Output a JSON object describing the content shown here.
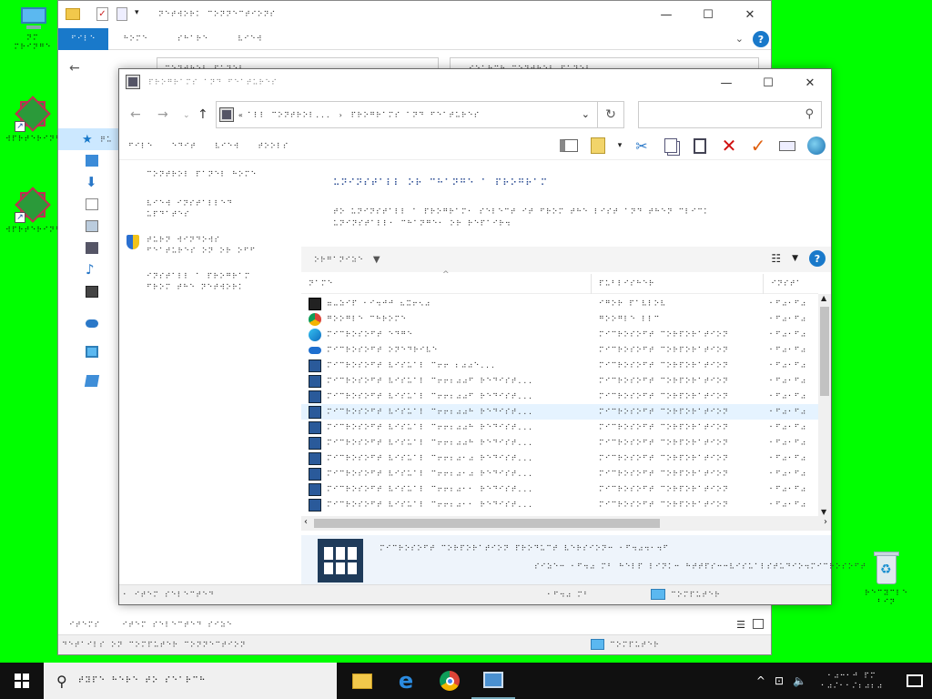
{
  "desktop": {
    "icons": [
      {
        "name": "this-pc",
        "label": "⠝⠍\n⠍⠗⠊⠝⠛⠑"
      },
      {
        "name": "shortcut-1",
        "label": "⠺⠏⠗⠞⠑⠗⠊⠝⠛⠗"
      },
      {
        "name": "shortcut-2",
        "label": "⠺⠏⠗⠞⠑⠗⠊⠝⠛⠗"
      },
      {
        "name": "recycle-bin",
        "label": "⠗⠑⠉⠽⠉⠇⠑\n⠃⠊⠝"
      }
    ]
  },
  "back_window": {
    "title": "⠝⠑⠞⠺⠕⠗⠅ ⠉⠕⠝⠝⠑⠉⠞⠊⠕⠝⠎",
    "tabs": [
      "⠋⠊⠇⠑",
      "⠓⠕⠍⠑",
      "⠎⠓⠁⠗⠑",
      "⠧⠊⠑⠺"
    ],
    "address": "⠉⠕⠝⠞⠗⠕⠇ ⠏⠁⠝⠑⠇",
    "search_placeholder": "⠎⠑⠁⠗⠉⠓ ⠉⠕⠝⠞⠗⠕⠇ ⠏⠁⠝⠑⠇",
    "side_items": [
      "⠟⠥",
      "⠙⠑",
      "⠙⠕",
      "⠙⠕",
      "⠏⠊",
      "⠙⠑",
      "⠍⠥",
      "⠧⠊",
      "⠕⠝",
      "⠞⠓",
      "⠝⠑"
    ],
    "status_left": "⠊⠞⠑⠍⠎",
    "status_mid": "⠊⠞⠑⠍ ⠎⠑⠇⠑⠉⠞⠑⠙ ⠎⠊⠵⠑",
    "footer_left": "⠙⠑⠞⠁⠊⠇⠎ ⠕⠝ ⠉⠕⠍⠏⠥⠞⠑⠗ ⠉⠕⠝⠝⠑⠉⠞⠊⠕⠝",
    "footer_right": "⠉⠕⠍⠏⠥⠞⠑⠗"
  },
  "front_window": {
    "title": "⠏⠗⠕⠛⠗⠁⠍⠎ ⠁⠝⠙ ⠋⠑⠁⠞⠥⠗⠑⠎",
    "address_parts": [
      "«",
      "⠁⠇⠇ ⠉⠕⠝⠞⠗⠕⠇...",
      "›",
      "⠏⠗⠕⠛⠗⠁⠍⠎ ⠁⠝⠙ ⠋⠑⠁⠞⠥⠗⠑⠎"
    ],
    "search_placeholder": "",
    "menu": [
      "⠋⠊⠇⠑",
      "⠑⠙⠊⠞",
      "⠧⠊⠑⠺",
      "⠞⠕⠕⠇⠎"
    ],
    "left_nav": [
      "⠉⠕⠝⠞⠗⠕⠇ ⠏⠁⠝⠑⠇ ⠓⠕⠍⠑",
      "⠧⠊⠑⠺ ⠊⠝⠎⠞⠁⠇⠇⠑⠙\n⠥⠏⠙⠁⠞⠑⠎",
      "⠞⠥⠗⠝ ⠺⠊⠝⠙⠕⠺⠎\n⠋⠑⠁⠞⠥⠗⠑⠎ ⠕⠝ ⠕⠗ ⠕⠋⠋",
      "⠊⠝⠎⠞⠁⠇⠇ ⠁ ⠏⠗⠕⠛⠗⠁⠍\n⠋⠗⠕⠍ ⠞⠓⠑ ⠝⠑⠞⠺⠕⠗⠅"
    ],
    "heading": "⠥⠝⠊⠝⠎⠞⠁⠇⠇ ⠕⠗ ⠉⠓⠁⠝⠛⠑ ⠁ ⠏⠗⠕⠛⠗⠁⠍",
    "description": "⠞⠕ ⠥⠝⠊⠝⠎⠞⠁⠇⠇ ⠁ ⠏⠗⠕⠛⠗⠁⠍⠂ ⠎⠑⠇⠑⠉⠞ ⠊⠞ ⠋⠗⠕⠍ ⠞⠓⠑ ⠇⠊⠎⠞ ⠁⠝⠙ ⠞⠓⠑⠝ ⠉⠇⠊⠉⠅\n⠥⠝⠊⠝⠎⠞⠁⠇⠇⠂ ⠉⠓⠁⠝⠛⠑⠂ ⠕⠗ ⠗⠑⠏⠁⠊⠗⠲",
    "organize": "⠕⠗⠛⠁⠝⠊⠵⠑",
    "columns": [
      "⠝⠁⠍⠑",
      "⠏⠥⠃⠇⠊⠎⠓⠑⠗",
      "⠊⠝⠎⠞⠁"
    ],
    "rows": [
      {
        "icon": "7zip-icon",
        "name": "⠶⠤⠵⠊⠏ ⠂⠊⠲⠚⠚ ⠦⠭⠖⠢⠴",
        "publisher": "⠊⠛⠕⠗ ⠏⠁⠧⠇⠕⠧",
        "date": "⠂⠋⠴⠂⠋⠴"
      },
      {
        "icon": "chrome-icon",
        "name": "⠛⠕⠕⠛⠇⠑ ⠉⠓⠗⠕⠍⠑",
        "publisher": "⠛⠕⠕⠛⠇⠑ ⠇⠇⠉",
        "date": "⠂⠋⠴⠂⠋⠴"
      },
      {
        "icon": "edge-icon",
        "name": "⠍⠊⠉⠗⠕⠎⠕⠋⠞ ⠑⠙⠛⠑",
        "publisher": "⠍⠊⠉⠗⠕⠎⠕⠋⠞ ⠉⠕⠗⠏⠕⠗⠁⠞⠊⠕⠝",
        "date": "⠂⠋⠴⠂⠋⠴"
      },
      {
        "icon": "onedrive-icon",
        "name": "⠍⠊⠉⠗⠕⠎⠕⠋⠞ ⠕⠝⠑⠙⠗⠊⠧⠑",
        "publisher": "⠍⠊⠉⠗⠕⠎⠕⠋⠞ ⠉⠕⠗⠏⠕⠗⠁⠞⠊⠕⠝",
        "date": "⠂⠋⠴⠂⠋⠴"
      },
      {
        "icon": "vcredist-icon",
        "name": "⠍⠊⠉⠗⠕⠎⠕⠋⠞ ⠧⠊⠎⠥⠁⠇ ⠉⠖⠖ ⠆⠴⠴⠑...",
        "publisher": "⠍⠊⠉⠗⠕⠎⠕⠋⠞ ⠉⠕⠗⠏⠕⠗⠁⠞⠊⠕⠝",
        "date": "⠂⠋⠴⠂⠋⠴"
      },
      {
        "icon": "vcredist-icon",
        "name": "⠍⠊⠉⠗⠕⠎⠕⠋⠞ ⠧⠊⠎⠥⠁⠇ ⠉⠖⠖⠆⠴⠴⠋ ⠗⠑⠙⠊⠎⠞...",
        "publisher": "⠍⠊⠉⠗⠕⠎⠕⠋⠞ ⠉⠕⠗⠏⠕⠗⠁⠞⠊⠕⠝",
        "date": "⠂⠋⠴⠂⠋⠴"
      },
      {
        "icon": "vcredist-icon",
        "name": "⠍⠊⠉⠗⠕⠎⠕⠋⠞ ⠧⠊⠎⠥⠁⠇ ⠉⠖⠖⠆⠴⠴⠋ ⠗⠑⠙⠊⠎⠞...",
        "publisher": "⠍⠊⠉⠗⠕⠎⠕⠋⠞ ⠉⠕⠗⠏⠕⠗⠁⠞⠊⠕⠝",
        "date": "⠂⠋⠴⠂⠋⠴"
      },
      {
        "icon": "vcredist-icon",
        "name": "⠍⠊⠉⠗⠕⠎⠕⠋⠞ ⠧⠊⠎⠥⠁⠇ ⠉⠖⠖⠆⠴⠴⠓ ⠗⠑⠙⠊⠎⠞...",
        "publisher": "⠍⠊⠉⠗⠕⠎⠕⠋⠞ ⠉⠕⠗⠏⠕⠗⠁⠞⠊⠕⠝",
        "date": "⠂⠋⠴⠂⠋⠴"
      },
      {
        "icon": "vcredist-icon",
        "name": "⠍⠊⠉⠗⠕⠎⠕⠋⠞ ⠧⠊⠎⠥⠁⠇ ⠉⠖⠖⠆⠴⠴⠓ ⠗⠑⠙⠊⠎⠞...",
        "publisher": "⠍⠊⠉⠗⠕⠎⠕⠋⠞ ⠉⠕⠗⠏⠕⠗⠁⠞⠊⠕⠝",
        "date": "⠂⠋⠴⠂⠋⠴"
      },
      {
        "icon": "vcredist-icon",
        "name": "⠍⠊⠉⠗⠕⠎⠕⠋⠞ ⠧⠊⠎⠥⠁⠇ ⠉⠖⠖⠆⠴⠴⠓ ⠗⠑⠙⠊⠎⠞...",
        "publisher": "⠍⠊⠉⠗⠕⠎⠕⠋⠞ ⠉⠕⠗⠏⠕⠗⠁⠞⠊⠕⠝",
        "date": "⠂⠋⠴⠂⠋⠴"
      },
      {
        "icon": "vcredist-icon",
        "name": "⠍⠊⠉⠗⠕⠎⠕⠋⠞ ⠧⠊⠎⠥⠁⠇ ⠉⠖⠖⠆⠴⠂⠴ ⠗⠑⠙⠊⠎⠞...",
        "publisher": "⠍⠊⠉⠗⠕⠎⠕⠋⠞ ⠉⠕⠗⠏⠕⠗⠁⠞⠊⠕⠝",
        "date": "⠂⠋⠴⠂⠋⠴"
      },
      {
        "icon": "vcredist-icon",
        "name": "⠍⠊⠉⠗⠕⠎⠕⠋⠞ ⠧⠊⠎⠥⠁⠇ ⠉⠖⠖⠆⠴⠂⠴ ⠗⠑⠙⠊⠎⠞...",
        "publisher": "⠍⠊⠉⠗⠕⠎⠕⠋⠞ ⠉⠕⠗⠏⠕⠗⠁⠞⠊⠕⠝",
        "date": "⠂⠋⠴⠂⠋⠴"
      },
      {
        "icon": "vcredist-icon",
        "name": "⠍⠊⠉⠗⠕⠎⠕⠋⠞ ⠧⠊⠎⠥⠁⠇ ⠉⠖⠖⠆⠴⠂⠂ ⠗⠑⠙⠊⠎⠞...",
        "publisher": "⠍⠊⠉⠗⠕⠎⠕⠋⠞ ⠉⠕⠗⠏⠕⠗⠁⠞⠊⠕⠝",
        "date": "⠂⠋⠴⠂⠋⠴"
      },
      {
        "icon": "vcredist-icon",
        "name": "⠍⠊⠉⠗⠕⠎⠕⠋⠞ ⠧⠊⠎⠥⠁⠇ ⠉⠖⠖⠆⠴⠂⠂ ⠗⠑⠙⠊⠎⠞...",
        "publisher": "⠍⠊⠉⠗⠕⠎⠕⠋⠞ ⠉⠕⠗⠏⠕⠗⠁⠞⠊⠕⠝",
        "date": "⠂⠋⠴⠂⠋⠴"
      }
    ],
    "selected_row_index": 7,
    "details_line1": "⠍⠊⠉⠗⠕⠎⠕⠋⠞ ⠉⠕⠗⠏⠕⠗⠁⠞⠊⠕⠝  ⠏⠗⠕⠙⠥⠉⠞ ⠧⠑⠗⠎⠊⠕⠝⠒   ⠂⠋⠲⠴⠲⠂⠲⠋",
    "details_line2": "⠎⠊⠵⠑⠒ ⠂⠋⠲⠴ ⠍⠃   ⠓⠑⠇⠏ ⠇⠊⠝⠅⠒ ⠓⠞⠞⠏⠎⠒⠒⠧⠊⠎⠥⠁⠇⠎⠞⠥⠙⠊⠕⠲⠍⠊⠉⠗⠕⠎⠕⠋⠞",
    "status_left": "⠂ ⠊⠞⠑⠍ ⠎⠑⠇⠑⠉⠞⠑⠙",
    "status_mid": "⠂⠋⠲⠴ ⠍⠃",
    "status_right": "⠉⠕⠍⠏⠥⠞⠑⠗"
  },
  "taskbar": {
    "search_text": "⠞⠽⠏⠑ ⠓⠑⠗⠑ ⠞⠕ ⠎⠑⠁⠗⠉⠓",
    "clock_time": "⠂⠴⠒⠂⠚ ⠏⠍",
    "clock_date": "⠂⠴⠌⠂⠂⠌⠆⠴⠆⠴"
  }
}
